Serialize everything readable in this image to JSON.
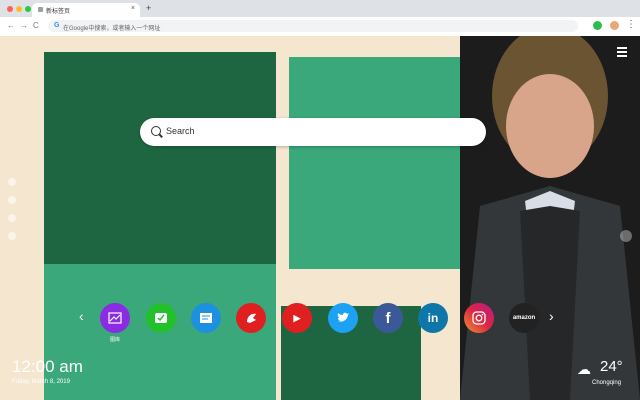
{
  "browser": {
    "tab_title": "新标签页",
    "tab_close": "×",
    "new_tab": "+",
    "back": "←",
    "forward": "→",
    "reload": "C",
    "address_g": "G",
    "address_text": "在Google中搜索，或者输入一个网址",
    "menu": "⋮"
  },
  "page": {
    "search_placeholder": "Search",
    "apps": [
      {
        "name": "图库",
        "icon": "gallery-icon",
        "color": "#8b2be2"
      },
      {
        "name": "tasks",
        "icon": "check-icon",
        "color": "#22c02a"
      },
      {
        "name": "notes",
        "icon": "note-icon",
        "color": "#1e90e0"
      },
      {
        "name": "chrome-game",
        "icon": "game-icon",
        "color": "#e02020"
      },
      {
        "name": "YouTube",
        "icon": "youtube-icon",
        "color": "#e02020"
      },
      {
        "name": "Twitter",
        "icon": "twitter-icon",
        "color": "#1da1f2"
      },
      {
        "name": "Facebook",
        "icon": "facebook-icon",
        "color": "#3b5998"
      },
      {
        "name": "LinkedIn",
        "icon": "linkedin-icon",
        "color": "#0e76a8"
      },
      {
        "name": "Instagram",
        "icon": "instagram-icon",
        "color": "#d6249f"
      },
      {
        "name": "amazon",
        "icon": "amazon-icon",
        "color": "#222222"
      }
    ],
    "app_label_first": "图库",
    "twitter_glyph": "🐦",
    "facebook_glyph": "f",
    "linkedin_glyph": "in",
    "youtube_glyph": "▶",
    "amazon_glyph": "amazon",
    "arrow_left": "‹",
    "arrow_right": "›",
    "clock": {
      "time": "12:00 am",
      "date": "Friday, March 8, 2019"
    },
    "weather": {
      "temp": "24°",
      "city": "Chongqing",
      "icon": "☁"
    }
  }
}
